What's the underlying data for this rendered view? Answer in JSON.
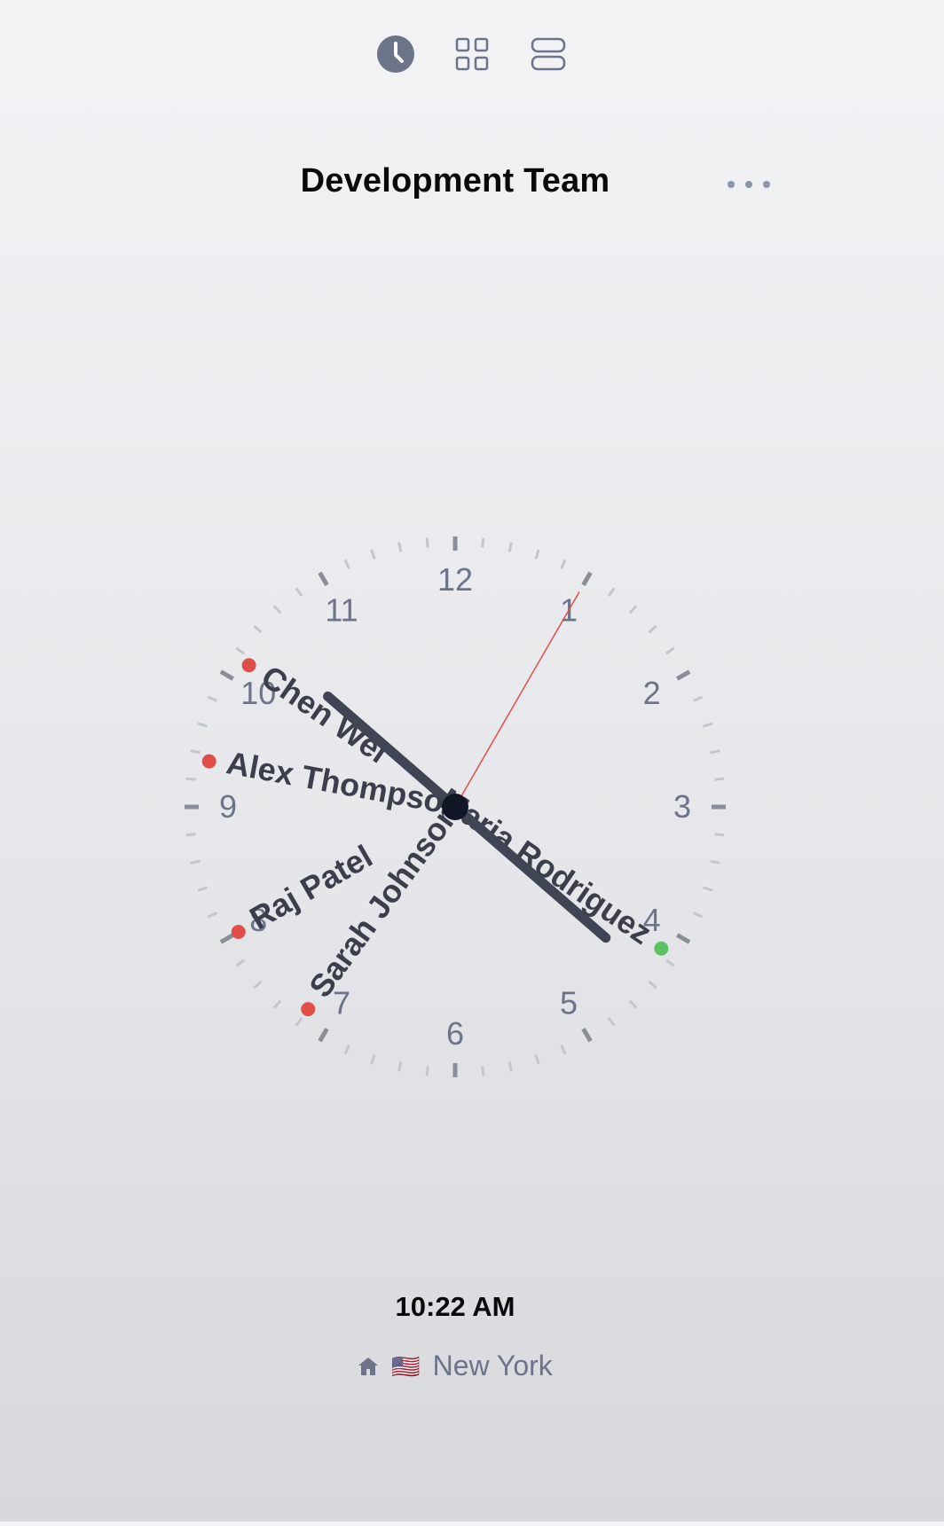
{
  "toolbar": {
    "items": [
      {
        "name": "clock-view",
        "icon": "clock-icon",
        "active": true
      },
      {
        "name": "grid-view",
        "icon": "grid-icon",
        "active": false
      },
      {
        "name": "list-view",
        "icon": "rows-icon",
        "active": false
      }
    ]
  },
  "header": {
    "title": "Development Team",
    "more_icon": "more-horizontal-icon"
  },
  "clock": {
    "numerals": [
      "12",
      "1",
      "2",
      "3",
      "4",
      "5",
      "6",
      "7",
      "8",
      "9",
      "10",
      "11"
    ],
    "members": [
      {
        "name": "Chen Wei",
        "status": "away",
        "hour": 10.15
      },
      {
        "name": "Alex Thompson",
        "status": "away",
        "hour": 9.35
      },
      {
        "name": "Raj Patel",
        "status": "away",
        "hour": 8.0
      },
      {
        "name": "Sarah Johnson",
        "status": "away",
        "hour": 7.2
      },
      {
        "name": "Maria Rodriguez",
        "status": "online",
        "hour": 4.15
      }
    ],
    "hand_hours": 10.3667,
    "second_fraction": 0.0833,
    "colors": {
      "away": "#e04e4a",
      "online": "#5cc163",
      "hand": "#3f4553",
      "second": "#e04e4a",
      "numeral": "#6b7488"
    }
  },
  "footer": {
    "time": "10:22 AM",
    "home_icon": "home-icon",
    "flag": "🇺🇸",
    "city": "New York"
  }
}
